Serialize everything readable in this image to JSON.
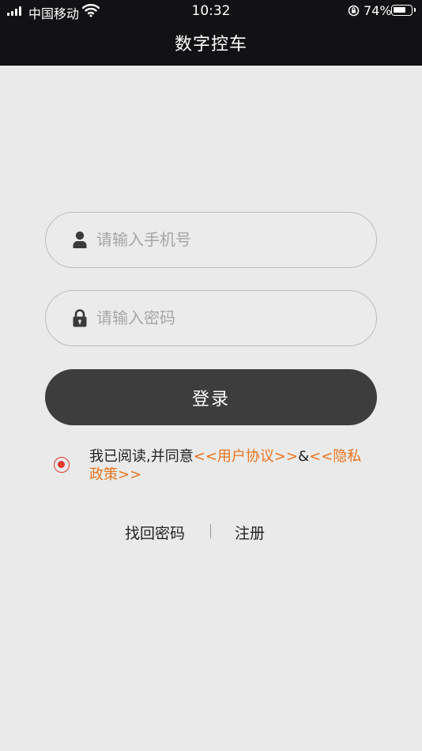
{
  "status_bar": {
    "carrier": "中国移动",
    "time": "10:32",
    "battery_percent": "74%",
    "battery_level": 0.74,
    "icons": [
      "signal-icon",
      "wifi-icon",
      "rotation-lock-icon",
      "battery-icon"
    ]
  },
  "header": {
    "title": "数字控车"
  },
  "login_form": {
    "phone_placeholder": "请输入手机号",
    "phone_value": "",
    "phone_icon": "user-icon",
    "password_placeholder": "请输入密码",
    "password_value": "",
    "password_icon": "lock-icon",
    "login_label": "登录"
  },
  "agreement": {
    "checked": true,
    "prefix": "我已阅读,并同意",
    "user_agreement": "<<用户协议>>",
    "joiner": "&",
    "privacy_policy": "<<隐私政策>>"
  },
  "footer_links": {
    "find_password": "找回密码",
    "register": "注册"
  },
  "colors": {
    "header_bg": "#121214",
    "page_bg": "#eaeaea",
    "button_bg": "#3d3d3d",
    "link": "#e8741c",
    "radio": "#e2382d"
  }
}
